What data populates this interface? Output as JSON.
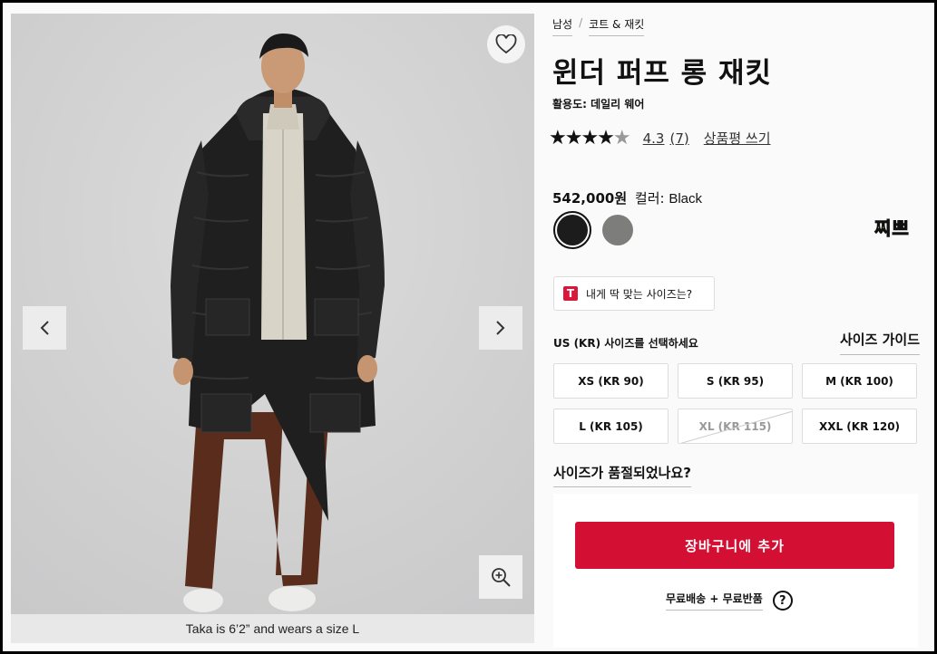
{
  "breadcrumb": {
    "items": [
      "남성",
      "코트 & 재킷"
    ],
    "separator": "/"
  },
  "product": {
    "title": "윈더 퍼프 롱 재킷",
    "activity": "활용도: 데일리 웨어",
    "rating": {
      "stars": 4.5,
      "score": "4.3",
      "count": "(7)",
      "write_review": "상품평 쓰기"
    },
    "price": "542,000원",
    "color_label": "컬러:",
    "color_value": "Black",
    "swatches": [
      {
        "name": "Black",
        "color": "#1c1c1c",
        "selected": true
      },
      {
        "name": "Grey",
        "color": "#7d7e7b",
        "selected": false
      }
    ],
    "badge": "찌쁘"
  },
  "gallery": {
    "caption": "Taka is 6’2” and wears a size L",
    "icons": {
      "wishlist": "heart-icon",
      "prev": "chevron-left-icon",
      "next": "chevron-right-icon",
      "zoom": "zoom-in-icon"
    }
  },
  "fit_finder": {
    "icon_letter": "T",
    "label": "내게 딱 맞는 사이즈는?"
  },
  "sizes": {
    "prompt": "US (KR) 사이즈를 선택하세요",
    "guide": "사이즈 가이드",
    "options": [
      {
        "label": "XS (KR 90)",
        "available": true
      },
      {
        "label": "S (KR 95)",
        "available": true
      },
      {
        "label": "M (KR 100)",
        "available": true
      },
      {
        "label": "L (KR 105)",
        "available": true
      },
      {
        "label": "XL (KR 115)",
        "available": false
      },
      {
        "label": "XXL (KR 120)",
        "available": true
      }
    ],
    "sold_out_question": "사이즈가 품절되었나요?"
  },
  "cart": {
    "button": "장바구니에 추가",
    "shipping": "무료배송 + 무료반품",
    "help": "?"
  }
}
